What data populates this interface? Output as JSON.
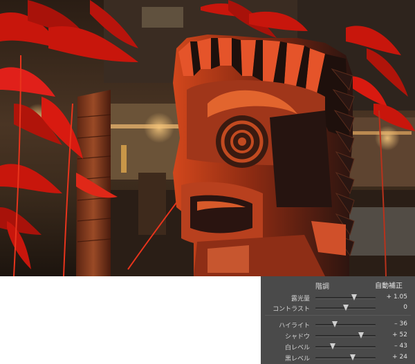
{
  "panel": {
    "title": "階調",
    "auto_label": "自動補正",
    "sliders_top": [
      {
        "key": "exposure",
        "label": "露光量",
        "value_text": "+ 1.05",
        "position": 0.64
      },
      {
        "key": "contrast",
        "label": "コントラスト",
        "value_text": "0",
        "position": 0.5
      }
    ],
    "sliders_bottom": [
      {
        "key": "highlights",
        "label": "ハイライト",
        "value_text": "– 36",
        "position": 0.32
      },
      {
        "key": "shadows",
        "label": "シャドウ",
        "value_text": "+ 52",
        "position": 0.76
      },
      {
        "key": "whites",
        "label": "白レベル",
        "value_text": "– 43",
        "position": 0.29
      },
      {
        "key": "blacks",
        "label": "黒レベル",
        "value_text": "+ 24",
        "position": 0.62
      }
    ]
  }
}
